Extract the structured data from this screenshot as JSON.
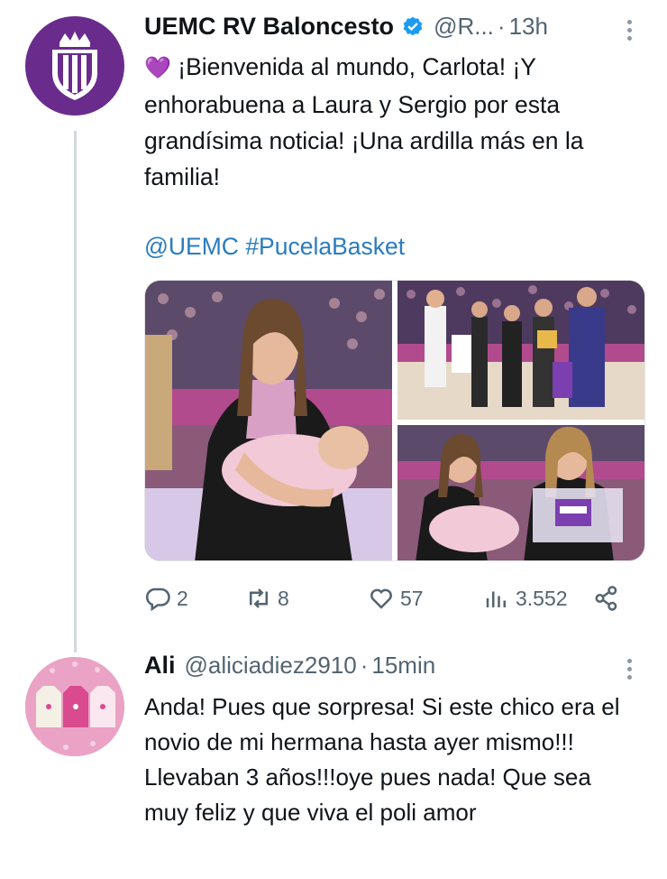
{
  "tweet": {
    "display_name": "UEMC RV Baloncesto",
    "handle": "@R...",
    "separator": "·",
    "time": "13h",
    "emoji": "💜",
    "text": "¡Bienvenida al mundo, Carlota! ¡Y enhorabuena a Laura y Sergio por esta grandísima noticia! ¡Una ardilla más en la familia!",
    "mention": "@UEMC",
    "hashtag": "#PucelaBasket",
    "actions": {
      "replies": "2",
      "retweets": "8",
      "likes": "57",
      "views": "3.552"
    },
    "icons": [
      "verified-badge-icon",
      "more-icon",
      "reply-icon",
      "retweet-icon",
      "like-icon",
      "views-icon",
      "share-icon"
    ]
  },
  "reply": {
    "display_name": "Ali",
    "handle": "@aliciadiez2910",
    "separator": "·",
    "time": "15min",
    "text": "Anda! Pues que sorpresa! Si este chico era el novio de mi hermana hasta ayer mismo!!! Llevaban 3 años!!!oye pues nada! Que sea muy feliz y que viva el poli amor"
  },
  "colors": {
    "accent": "#1d9bf0",
    "brand_purple": "#6a2c8c",
    "muted": "#536471"
  }
}
